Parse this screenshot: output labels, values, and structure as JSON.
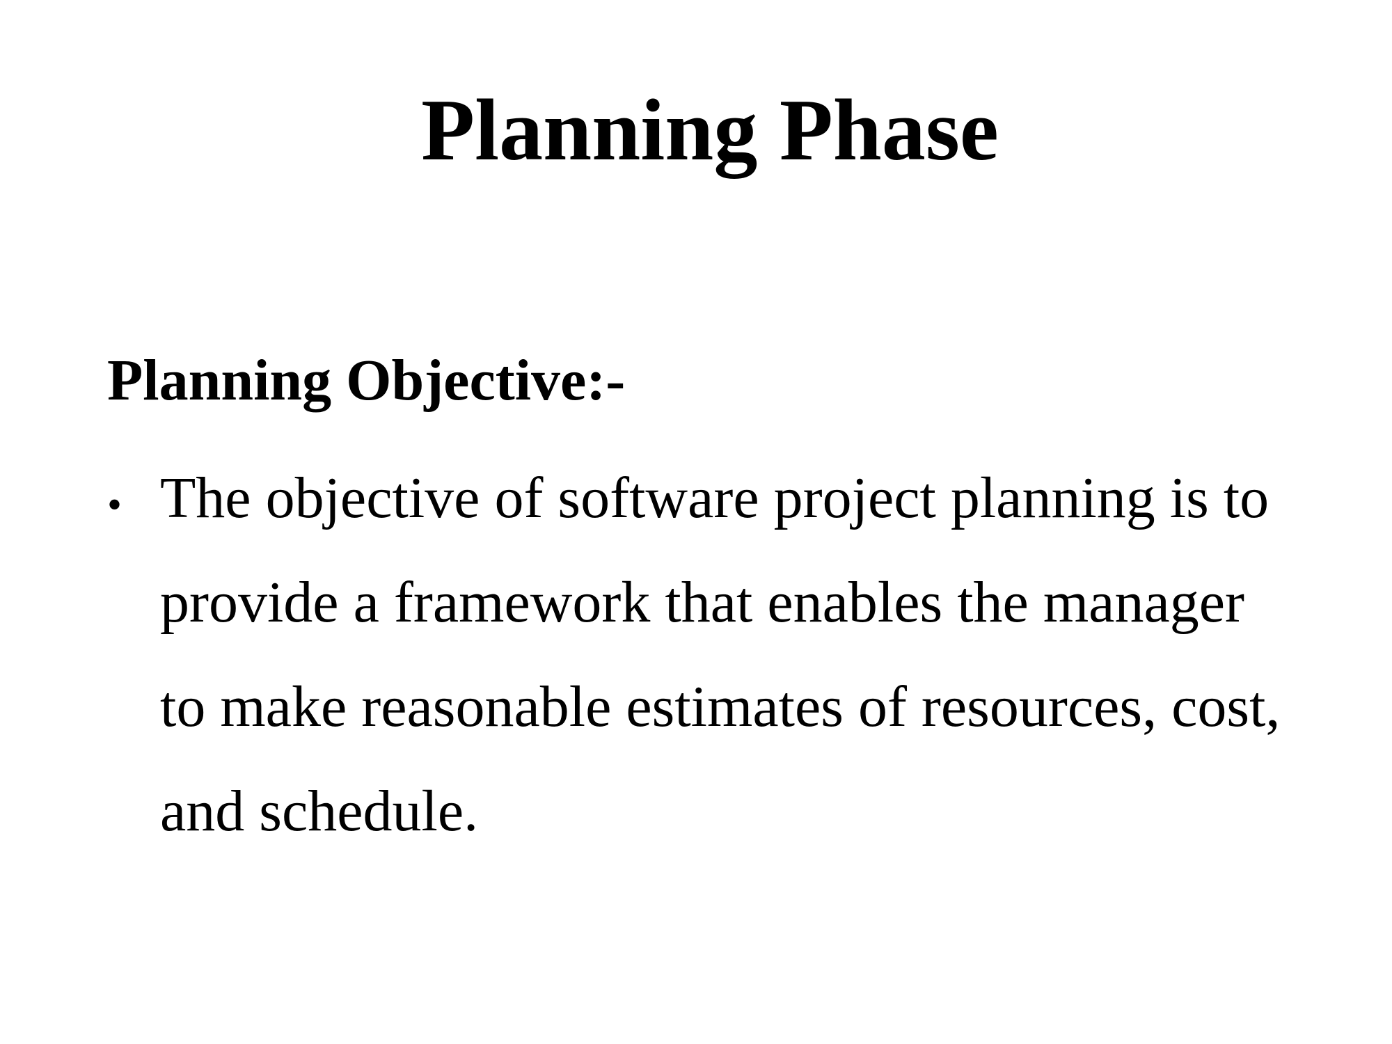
{
  "slide": {
    "title": "Planning Phase",
    "subheading": "Planning Objective:-",
    "bullets": [
      {
        "marker": "•",
        "lines": [
          "The objective of software project planning is to",
          "provide a framework that enables the manager",
          "to make reasonable estimates of resources, cost,",
          "and schedule."
        ]
      }
    ]
  },
  "colors": {
    "background": "#ffffff",
    "text": "#000000"
  }
}
